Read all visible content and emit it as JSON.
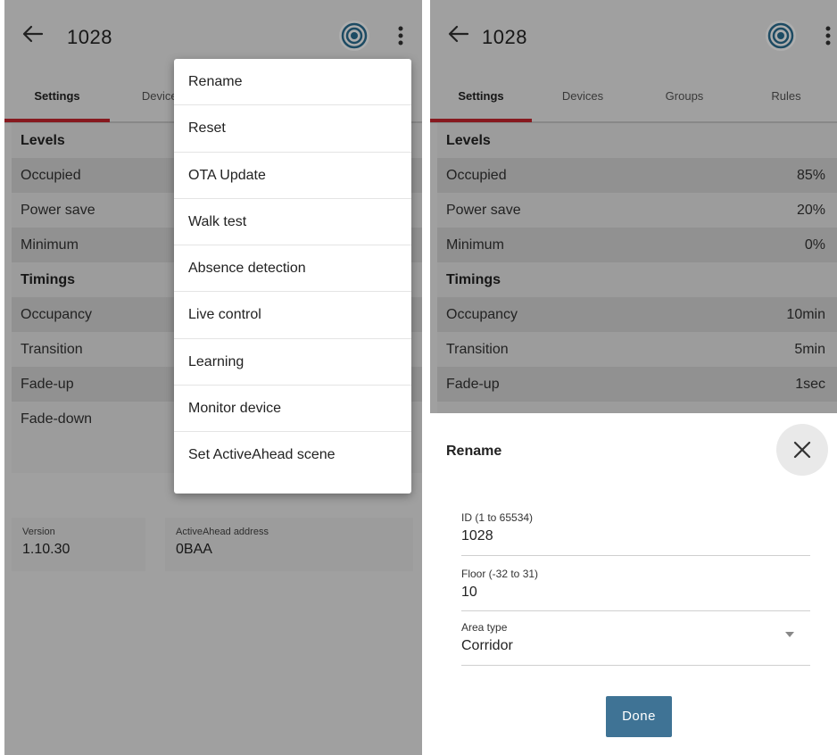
{
  "left": {
    "appbar": {
      "title": "1028"
    },
    "tabs": [
      {
        "label": "Settings",
        "active": true
      },
      {
        "label": "Devices",
        "active": false
      }
    ],
    "rows": [
      {
        "label": "Levels",
        "header": true
      },
      {
        "label": "Occupied"
      },
      {
        "label": "Power save"
      },
      {
        "label": "Minimum"
      },
      {
        "label": "Timings",
        "header": true
      },
      {
        "label": "Occupancy"
      },
      {
        "label": "Transition"
      },
      {
        "label": "Fade-up"
      },
      {
        "label": "Fade-down"
      }
    ],
    "version": {
      "label": "Version",
      "value": "1.10.30"
    },
    "address": {
      "label": "ActiveAhead address",
      "value": "0BAA"
    },
    "menu": {
      "items": [
        "Rename",
        "Reset",
        "OTA Update",
        "Walk test",
        "Absence detection",
        "Live control",
        "Learning",
        "Monitor device",
        "Set ActiveAhead scene"
      ]
    }
  },
  "right": {
    "appbar": {
      "title": "1028"
    },
    "tabs": [
      {
        "label": "Settings",
        "active": true
      },
      {
        "label": "Devices",
        "active": false
      },
      {
        "label": "Groups",
        "active": false
      },
      {
        "label": "Rules",
        "active": false
      }
    ],
    "rows": [
      {
        "label": "Levels",
        "value": "",
        "header": true
      },
      {
        "label": "Occupied",
        "value": "85%"
      },
      {
        "label": "Power save",
        "value": "20%"
      },
      {
        "label": "Minimum",
        "value": "0%"
      },
      {
        "label": "Timings",
        "value": "",
        "header": true
      },
      {
        "label": "Occupancy",
        "value": "10min"
      },
      {
        "label": "Transition",
        "value": "5min"
      },
      {
        "label": "Fade-up",
        "value": "1sec"
      }
    ],
    "sheet": {
      "title": "Rename",
      "fields": [
        {
          "label": "ID (1 to 65534)",
          "value": "1028"
        },
        {
          "label": "Floor (-32 to 31)",
          "value": "10"
        },
        {
          "label": "Area type",
          "value": "Corridor",
          "dropdown": true
        }
      ],
      "done_label": "Done"
    }
  },
  "colors": {
    "accent_red": "#c8262e",
    "done_button": "#3f7395",
    "row_dark": "#d6d6d6",
    "row_light": "#e6e6e6"
  },
  "icons": [
    "back-arrow-icon",
    "target-icon",
    "more-vert-icon",
    "close-icon",
    "dropdown-arrow-icon"
  ]
}
